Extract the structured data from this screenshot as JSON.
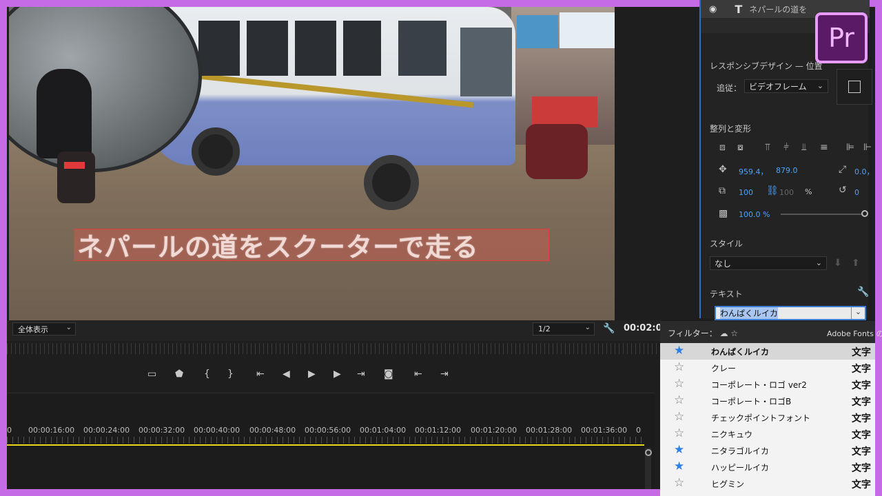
{
  "title_overlay": "ネパールの道をスクーターで走る",
  "layer": {
    "name": "ネパールの道を"
  },
  "responsive": {
    "label": "レスポンシブデザイン — 位置",
    "follow_label": "追従：",
    "follow_value": "ビデオフレーム"
  },
  "align": {
    "label": "整列と変形",
    "pos_x": "959.4，",
    "pos_y": "879.0",
    "anchor": "0.0，",
    "scale": "100",
    "scale2": "100",
    "percent": "%",
    "rotation": "0",
    "opacity": "100.0 %"
  },
  "style": {
    "label": "スタイル",
    "value": "なし"
  },
  "text": {
    "label": "テキスト",
    "font_value": "わんぱくルイカ"
  },
  "monitor": {
    "fit": "全体表示",
    "resolution": "1/2",
    "timecode": "00:02:0"
  },
  "timeline": {
    "timecodes": [
      "0",
      "00:00:16:00",
      "00:00:24:00",
      "00:00:32:00",
      "00:00:40:00",
      "00:00:48:00",
      "00:00:56:00",
      "00:01:04:00",
      "00:01:12:00",
      "00:01:20:00",
      "00:01:28:00",
      "00:01:36:00",
      "0"
    ]
  },
  "font_popup": {
    "filter_label": "フィルター：",
    "adobe_fonts": "Adobe Fonts の",
    "fonts": [
      {
        "name": "わんぱくルイカ",
        "sample": "文字",
        "starred": true,
        "selected": true
      },
      {
        "name": "クレー",
        "sample": "文字",
        "starred": false,
        "selected": false
      },
      {
        "name": "コーポレート・ロゴ ver2",
        "sample": "文字",
        "starred": false,
        "selected": false
      },
      {
        "name": "コーポレート・ロゴB",
        "sample": "文字",
        "starred": false,
        "selected": false
      },
      {
        "name": "チェックポイントフォント",
        "sample": "文字",
        "starred": false,
        "selected": false
      },
      {
        "name": "ニクキュウ",
        "sample": "文字",
        "starred": false,
        "selected": false
      },
      {
        "name": "ニタラゴルイカ",
        "sample": "文字",
        "starred": true,
        "selected": false
      },
      {
        "name": "ハッピールイカ",
        "sample": "文字",
        "starred": true,
        "selected": false
      },
      {
        "name": "ヒグミン",
        "sample": "文字",
        "starred": false,
        "selected": false
      }
    ]
  },
  "logo": "Pr",
  "colors": {
    "accent": "#2d7fe0",
    "frame": "#c56be6",
    "highlight": "#e9d51a"
  }
}
